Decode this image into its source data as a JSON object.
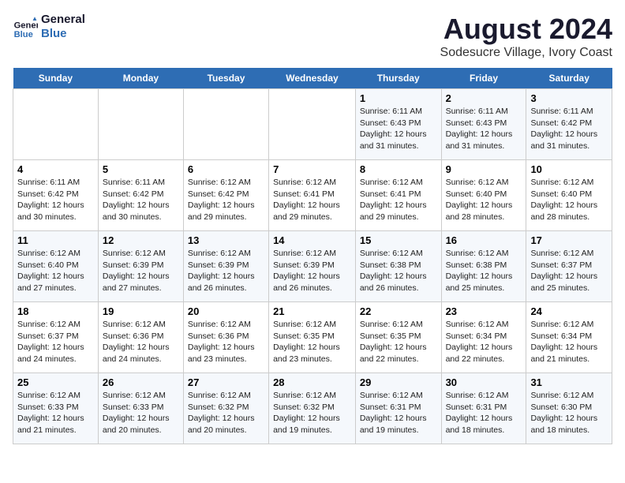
{
  "header": {
    "logo_line1": "General",
    "logo_line2": "Blue",
    "title": "August 2024",
    "subtitle": "Sodesucre Village, Ivory Coast"
  },
  "weekdays": [
    "Sunday",
    "Monday",
    "Tuesday",
    "Wednesday",
    "Thursday",
    "Friday",
    "Saturday"
  ],
  "weeks": [
    [
      {
        "day": "",
        "info": ""
      },
      {
        "day": "",
        "info": ""
      },
      {
        "day": "",
        "info": ""
      },
      {
        "day": "",
        "info": ""
      },
      {
        "day": "1",
        "info": "Sunrise: 6:11 AM\nSunset: 6:43 PM\nDaylight: 12 hours\nand 31 minutes."
      },
      {
        "day": "2",
        "info": "Sunrise: 6:11 AM\nSunset: 6:43 PM\nDaylight: 12 hours\nand 31 minutes."
      },
      {
        "day": "3",
        "info": "Sunrise: 6:11 AM\nSunset: 6:42 PM\nDaylight: 12 hours\nand 31 minutes."
      }
    ],
    [
      {
        "day": "4",
        "info": "Sunrise: 6:11 AM\nSunset: 6:42 PM\nDaylight: 12 hours\nand 30 minutes."
      },
      {
        "day": "5",
        "info": "Sunrise: 6:11 AM\nSunset: 6:42 PM\nDaylight: 12 hours\nand 30 minutes."
      },
      {
        "day": "6",
        "info": "Sunrise: 6:12 AM\nSunset: 6:42 PM\nDaylight: 12 hours\nand 29 minutes."
      },
      {
        "day": "7",
        "info": "Sunrise: 6:12 AM\nSunset: 6:41 PM\nDaylight: 12 hours\nand 29 minutes."
      },
      {
        "day": "8",
        "info": "Sunrise: 6:12 AM\nSunset: 6:41 PM\nDaylight: 12 hours\nand 29 minutes."
      },
      {
        "day": "9",
        "info": "Sunrise: 6:12 AM\nSunset: 6:40 PM\nDaylight: 12 hours\nand 28 minutes."
      },
      {
        "day": "10",
        "info": "Sunrise: 6:12 AM\nSunset: 6:40 PM\nDaylight: 12 hours\nand 28 minutes."
      }
    ],
    [
      {
        "day": "11",
        "info": "Sunrise: 6:12 AM\nSunset: 6:40 PM\nDaylight: 12 hours\nand 27 minutes."
      },
      {
        "day": "12",
        "info": "Sunrise: 6:12 AM\nSunset: 6:39 PM\nDaylight: 12 hours\nand 27 minutes."
      },
      {
        "day": "13",
        "info": "Sunrise: 6:12 AM\nSunset: 6:39 PM\nDaylight: 12 hours\nand 26 minutes."
      },
      {
        "day": "14",
        "info": "Sunrise: 6:12 AM\nSunset: 6:39 PM\nDaylight: 12 hours\nand 26 minutes."
      },
      {
        "day": "15",
        "info": "Sunrise: 6:12 AM\nSunset: 6:38 PM\nDaylight: 12 hours\nand 26 minutes."
      },
      {
        "day": "16",
        "info": "Sunrise: 6:12 AM\nSunset: 6:38 PM\nDaylight: 12 hours\nand 25 minutes."
      },
      {
        "day": "17",
        "info": "Sunrise: 6:12 AM\nSunset: 6:37 PM\nDaylight: 12 hours\nand 25 minutes."
      }
    ],
    [
      {
        "day": "18",
        "info": "Sunrise: 6:12 AM\nSunset: 6:37 PM\nDaylight: 12 hours\nand 24 minutes."
      },
      {
        "day": "19",
        "info": "Sunrise: 6:12 AM\nSunset: 6:36 PM\nDaylight: 12 hours\nand 24 minutes."
      },
      {
        "day": "20",
        "info": "Sunrise: 6:12 AM\nSunset: 6:36 PM\nDaylight: 12 hours\nand 23 minutes."
      },
      {
        "day": "21",
        "info": "Sunrise: 6:12 AM\nSunset: 6:35 PM\nDaylight: 12 hours\nand 23 minutes."
      },
      {
        "day": "22",
        "info": "Sunrise: 6:12 AM\nSunset: 6:35 PM\nDaylight: 12 hours\nand 22 minutes."
      },
      {
        "day": "23",
        "info": "Sunrise: 6:12 AM\nSunset: 6:34 PM\nDaylight: 12 hours\nand 22 minutes."
      },
      {
        "day": "24",
        "info": "Sunrise: 6:12 AM\nSunset: 6:34 PM\nDaylight: 12 hours\nand 21 minutes."
      }
    ],
    [
      {
        "day": "25",
        "info": "Sunrise: 6:12 AM\nSunset: 6:33 PM\nDaylight: 12 hours\nand 21 minutes."
      },
      {
        "day": "26",
        "info": "Sunrise: 6:12 AM\nSunset: 6:33 PM\nDaylight: 12 hours\nand 20 minutes."
      },
      {
        "day": "27",
        "info": "Sunrise: 6:12 AM\nSunset: 6:32 PM\nDaylight: 12 hours\nand 20 minutes."
      },
      {
        "day": "28",
        "info": "Sunrise: 6:12 AM\nSunset: 6:32 PM\nDaylight: 12 hours\nand 19 minutes."
      },
      {
        "day": "29",
        "info": "Sunrise: 6:12 AM\nSunset: 6:31 PM\nDaylight: 12 hours\nand 19 minutes."
      },
      {
        "day": "30",
        "info": "Sunrise: 6:12 AM\nSunset: 6:31 PM\nDaylight: 12 hours\nand 18 minutes."
      },
      {
        "day": "31",
        "info": "Sunrise: 6:12 AM\nSunset: 6:30 PM\nDaylight: 12 hours\nand 18 minutes."
      }
    ]
  ]
}
